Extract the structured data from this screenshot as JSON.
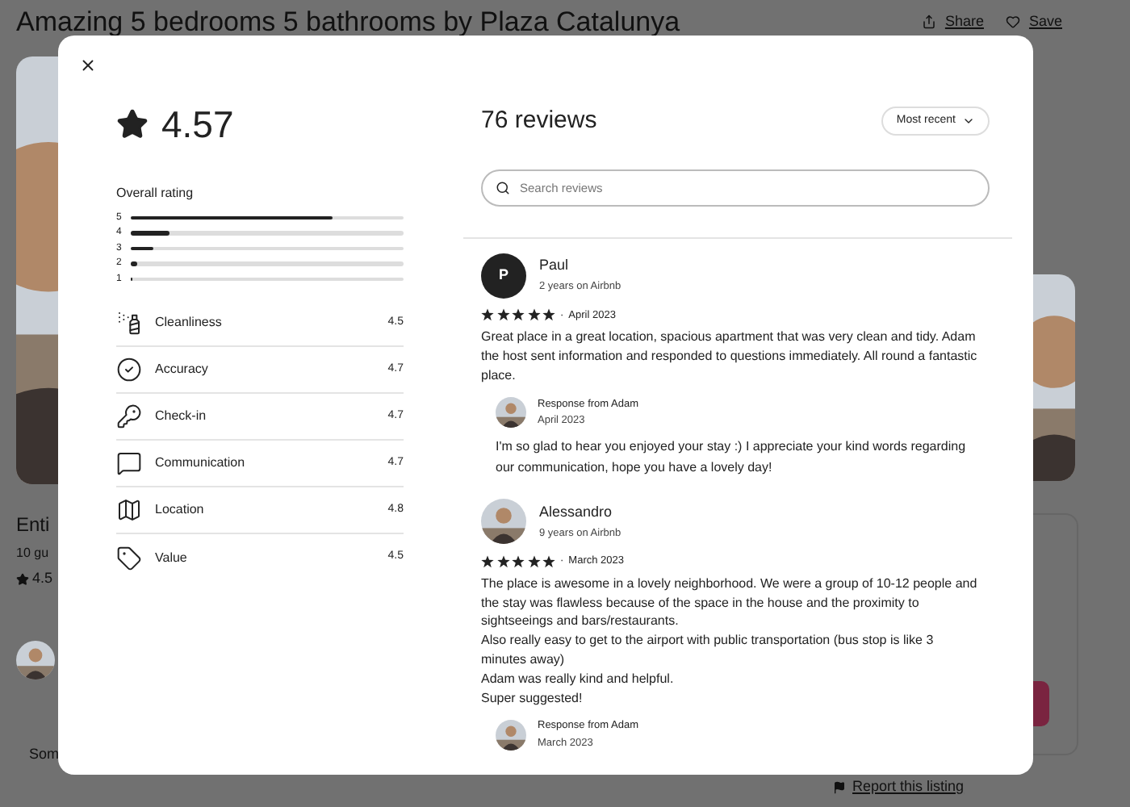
{
  "page": {
    "title": "Amazing 5 bedrooms 5 bathrooms by Plaza Catalunya",
    "actions": [
      {
        "kind": "share",
        "label": "Share"
      },
      {
        "kind": "save",
        "label": "Save"
      }
    ],
    "listing": {
      "title": "Enti",
      "guests": "10 gu",
      "rating": "4.5"
    },
    "section": "Som",
    "footer_link": "Report this listing"
  },
  "modal": {
    "rating": "4.57",
    "overall": {
      "label": "Overall rating",
      "bars": [
        {
          "label": "5",
          "level": 0.74
        },
        {
          "label": "4",
          "level": 0.14
        },
        {
          "label": "3",
          "level": 0.08
        },
        {
          "label": "2",
          "level": 0.025
        },
        {
          "label": "1",
          "level": 0.008
        }
      ]
    },
    "categories": [
      {
        "kind": "cleanliness",
        "name": "Cleanliness",
        "score": "4.5"
      },
      {
        "kind": "accuracy",
        "name": "Accuracy",
        "score": "4.7"
      },
      {
        "kind": "checkin",
        "name": "Check-in",
        "score": "4.7"
      },
      {
        "kind": "communication",
        "name": "Communication",
        "score": "4.7"
      },
      {
        "kind": "location",
        "name": "Location",
        "score": "4.8"
      },
      {
        "kind": "value",
        "name": "Value",
        "score": "4.5"
      }
    ],
    "reviews_count": "76 reviews",
    "sort": "Most recent",
    "search": {
      "placeholder": "Search reviews"
    },
    "reviews": [
      {
        "avatar": {
          "kind": "initial",
          "text": "P"
        },
        "name": "Paul",
        "tenure": "2 years on Airbnb",
        "stars": 5,
        "separator": "·",
        "date": "April 2023",
        "paragraphs": [
          "Great place in a great location, spacious apartment that was very clean and tidy. Adam the host sent information and responded to questions immediately. All round a fantastic place."
        ],
        "response": {
          "title": "Response from Adam",
          "date": "April 2023",
          "text": "I'm so glad to hear you enjoyed your stay :) I appreciate your kind words regarding our communication, hope you have a lovely day!"
        }
      },
      {
        "avatar": {
          "kind": "picture"
        },
        "name": "Alessandro",
        "tenure": "9 years on Airbnb",
        "stars": 5,
        "separator": "·",
        "date": "March 2023",
        "paragraphs": [
          "The place is awesome in a lovely neighborhood. We were a group of 10-12 people and the stay was flawless because of the space in the house and the proximity to sightseeings and bars/restaurants.",
          "Also really easy to get to the airport with public transportation (bus stop is like 3 minutes away)",
          "Adam was really kind and helpful.",
          "Super suggested!"
        ],
        "response": {
          "title": "Response from Adam",
          "date": "March 2023"
        }
      }
    ]
  }
}
